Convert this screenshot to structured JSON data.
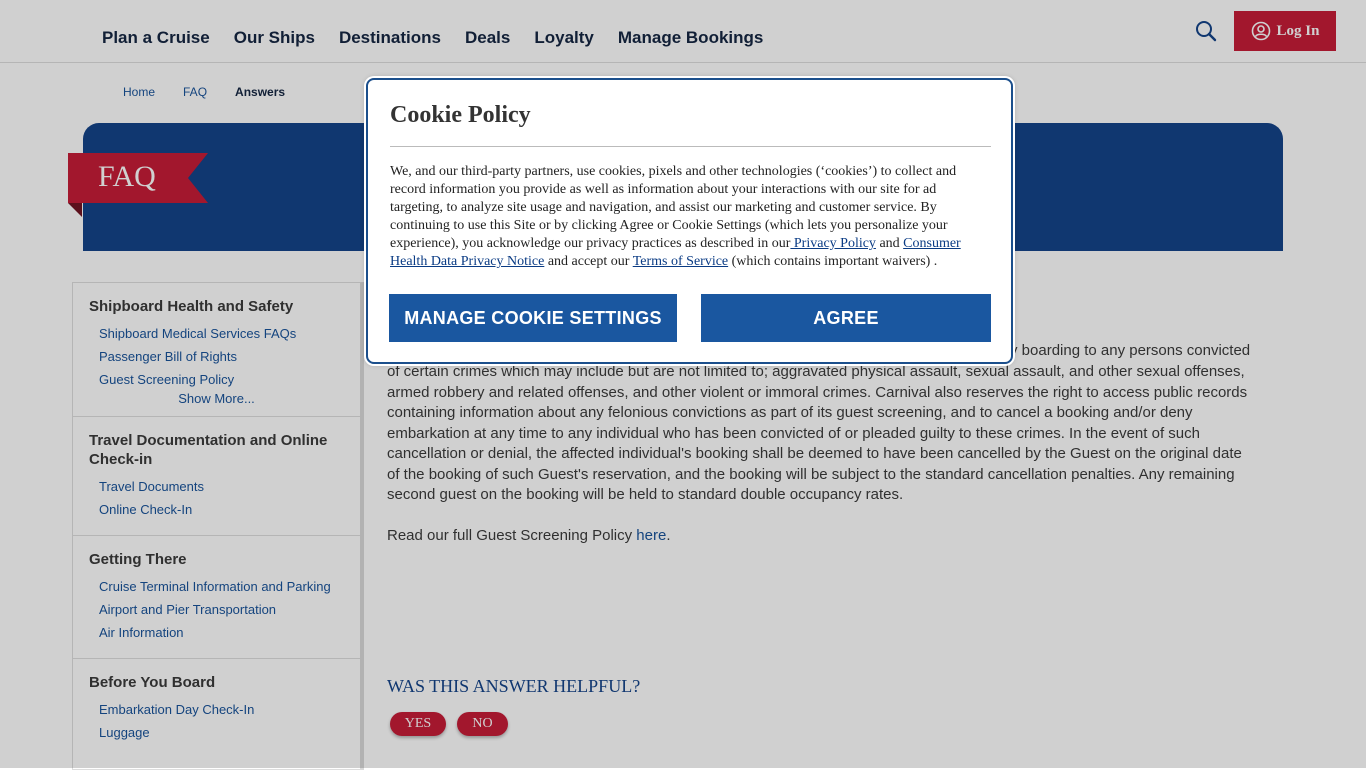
{
  "nav": {
    "items": [
      "Plan a Cruise",
      "Our Ships",
      "Destinations",
      "Deals",
      "Loyalty",
      "Manage Bookings"
    ],
    "login_label": "Log In",
    "search_icon": "search-icon",
    "user_icon": "user-circle-icon"
  },
  "breadcrumb": [
    "Home",
    "FAQ",
    "Answers"
  ],
  "banner": {
    "title": "FAQ"
  },
  "sidebar": [
    {
      "heading": "Shipboard Health and Safety",
      "links": [
        "Shipboard Medical Services FAQs",
        "Passenger Bill of Rights",
        "Guest Screening Policy"
      ],
      "more": "Show More..."
    },
    {
      "heading": "Travel Documentation and Online Check-in",
      "links": [
        "Travel Documents",
        "Online Check-In"
      ]
    },
    {
      "heading": "Getting There",
      "links": [
        "Cruise Terminal Information and Parking",
        "Airport and Pier Transportation",
        "Air Information"
      ]
    },
    {
      "heading": "Before You Board",
      "links": [
        "Embarkation Day Check-In",
        "Luggage"
      ]
    }
  ],
  "answer": {
    "visible_start": "y boarding to any persons convicted",
    "body": "of certain crimes which may include but are not limited to; aggravated physical assault, sexual assault, and other sexual offenses, armed robbery and related offenses, and other violent or immoral crimes. Carnival also reserves the right to access public records containing information about any felonious convictions as part of its guest screening, and to cancel a booking and/or deny embarkation at any time to any individual who has been convicted of or pleaded guilty to these crimes. In the event of such cancellation or denial, the affected individual's booking shall be deemed to have been cancelled by the Guest on the original date of the booking of such Guest's reservation, and the booking will be subject to the standard cancellation penalties. Any remaining second guest on the booking will be held to standard double occupancy rates.",
    "read_more_prefix": "Read our full Guest Screening Policy ",
    "read_more_link": "here",
    "read_more_suffix": "."
  },
  "helpful": {
    "question": "WAS THIS ANSWER HELPFUL?",
    "yes": "YES",
    "no": "NO"
  },
  "cookie": {
    "title": "Cookie Policy",
    "text_1": "We, and our third-party partners, use cookies, pixels and other technologies (‘cookies’) to collect and record information you provide as well as information about your interactions with our site for ad targeting, to analyze site usage and navigation, and assist our marketing and customer service. By continuing to use this Site or by clicking Agree or Cookie Settings (which lets you personalize your experience), you acknowledge our privacy practices as described in our",
    "privacy_link": " Privacy Policy",
    "and": " and ",
    "health_link": "Consumer Health Data Privacy Notice",
    "text_2": " and accept our ",
    "terms_link": "Terms of Service",
    "text_3": " (which contains important waivers) .",
    "manage_label": "MANAGE COOKIE SETTINGS",
    "agree_label": "AGREE"
  },
  "colors": {
    "brand_red": "#c4122f",
    "brand_blue": "#0a3b84",
    "button_blue": "#1a57a0"
  }
}
